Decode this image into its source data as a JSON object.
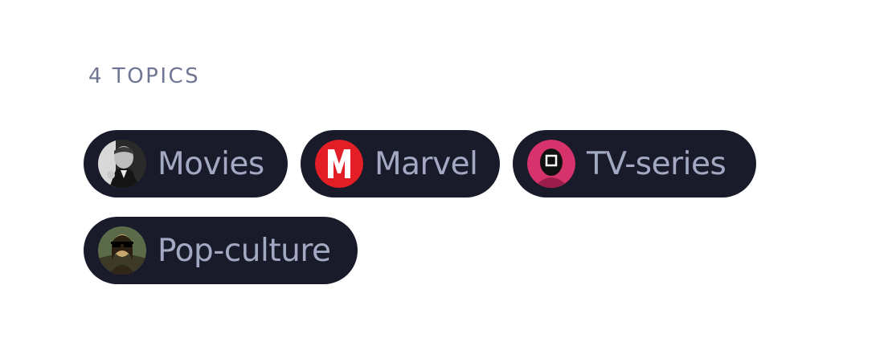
{
  "topics": {
    "count_label": "4 TOPICS",
    "items": [
      {
        "label": "Movies",
        "icon": "godfather-avatar-icon"
      },
      {
        "label": "Marvel",
        "icon": "marvel-logo-icon"
      },
      {
        "label": "TV-series",
        "icon": "squid-game-guard-icon"
      },
      {
        "label": "Pop-culture",
        "icon": "mona-lisa-sunglasses-icon"
      }
    ]
  },
  "colors": {
    "chip_background": "#1a1b2a",
    "chip_text": "#a3a8c3",
    "heading_text": "#6f7593",
    "marvel_red": "#e41e26",
    "squid_pink": "#d6336c"
  }
}
